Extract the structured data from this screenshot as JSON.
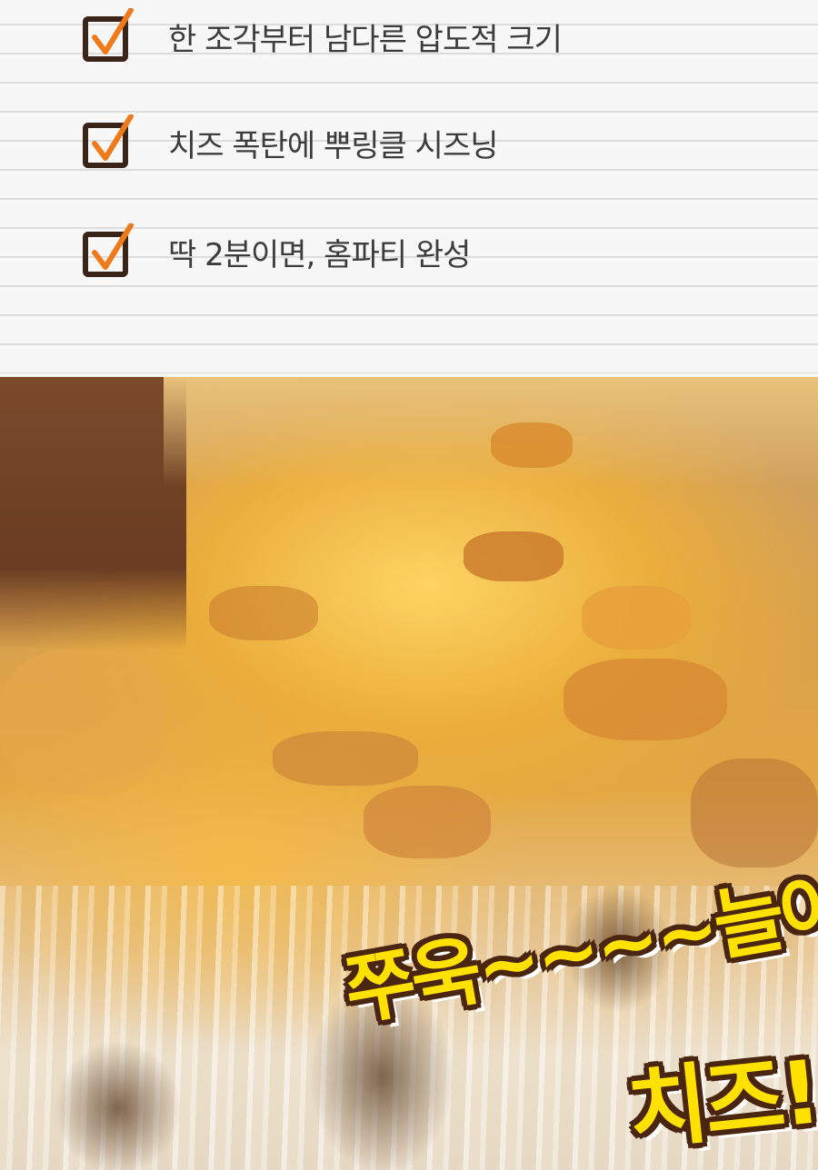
{
  "checklist": {
    "items": [
      {
        "label": "한 조각부터 남다른 압도적 크기"
      },
      {
        "label": "치즈 폭탄에 뿌링클 시즈닝"
      },
      {
        "label": "딱 2분이면, 홈파티 완성"
      }
    ],
    "box_color": "#3a2418",
    "check_color": "#f07a1a"
  },
  "photo": {
    "caption_line1": "쭈욱~~~~늘어나는",
    "caption_line2": "치즈!",
    "caption_fill": "#ffe100",
    "caption_outline": "#4a2610"
  }
}
